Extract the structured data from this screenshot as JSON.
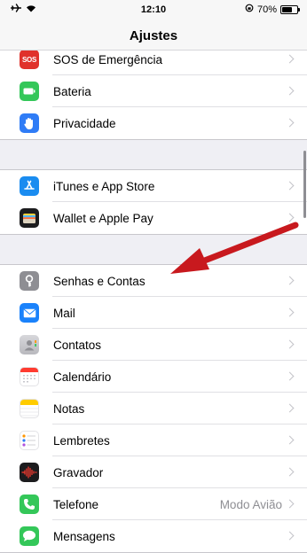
{
  "status_bar": {
    "time": "12:10",
    "battery_percent": "70%",
    "battery_level": 0.7,
    "left_icons": [
      "airplane-icon",
      "wifi-icon"
    ],
    "right_icons": [
      "rotation-lock-icon",
      "battery-icon"
    ]
  },
  "header": {
    "title": "Ajustes"
  },
  "groups": [
    {
      "items": [
        {
          "label": "SOS de Emergência",
          "icon": "sos-icon",
          "icon_text": "SOS",
          "color": "#e0312b"
        },
        {
          "label": "Bateria",
          "icon": "battery-settings-icon",
          "color": "#34c759"
        },
        {
          "label": "Privacidade",
          "icon": "hand-icon",
          "color": "#2f7cf6"
        }
      ]
    },
    {
      "items": [
        {
          "label": "iTunes e App Store",
          "icon": "app-store-icon",
          "color": "#1a8cf0"
        },
        {
          "label": "Wallet e Apple Pay",
          "icon": "wallet-icon",
          "color": "#1c1c1e"
        }
      ]
    },
    {
      "items": [
        {
          "label": "Senhas e Contas",
          "icon": "key-icon",
          "color": "#8e8e93"
        },
        {
          "label": "Mail",
          "icon": "mail-icon",
          "color": "#1a82fb"
        },
        {
          "label": "Contatos",
          "icon": "contacts-icon",
          "color": "#a8a8ad"
        },
        {
          "label": "Calendário",
          "icon": "calendar-icon",
          "color": "#ffffff"
        },
        {
          "label": "Notas",
          "icon": "notes-icon",
          "color": "#ffffff"
        },
        {
          "label": "Lembretes",
          "icon": "reminders-icon",
          "color": "#ffffff"
        },
        {
          "label": "Gravador",
          "icon": "voice-memos-icon",
          "color": "#1c1c1e"
        },
        {
          "label": "Telefone",
          "icon": "phone-icon",
          "color": "#34c759",
          "value": "Modo Avião"
        },
        {
          "label": "Mensagens",
          "icon": "messages-icon",
          "color": "#34c759"
        }
      ]
    }
  ],
  "annotation": {
    "type": "red-arrow",
    "color": "#c8191e",
    "points_to": "Senhas e Contas"
  }
}
